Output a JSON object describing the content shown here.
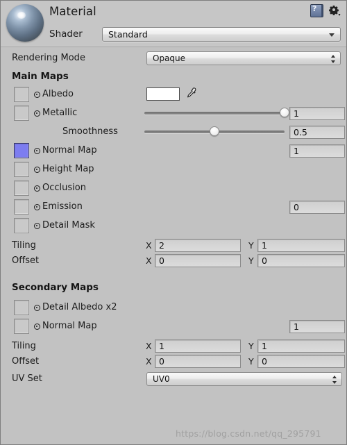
{
  "header": {
    "title": "Material",
    "shader_label": "Shader",
    "shader_value": "Standard",
    "help_icon": "help-book-icon",
    "settings_icon": "gear-icon",
    "preview_icon": "material-preview-sphere"
  },
  "rendering_mode": {
    "label": "Rendering Mode",
    "value": "Opaque"
  },
  "main_maps": {
    "heading": "Main Maps",
    "slots": [
      {
        "label": "Albedo",
        "filled": false,
        "swatch": "#ffffff",
        "has_color": true,
        "picker_icon": "eyedropper-icon"
      },
      {
        "label": "Metallic",
        "filled": false,
        "slider": 1,
        "value": "1"
      },
      {
        "label": "Smoothness",
        "filled": null,
        "slider": 0.5,
        "value": "0.5",
        "indented": true
      },
      {
        "label": "Normal Map",
        "filled": true,
        "swatch_color": "#7d7df0",
        "value": "1"
      },
      {
        "label": "Height Map",
        "filled": false
      },
      {
        "label": "Occlusion",
        "filled": false
      },
      {
        "label": "Emission",
        "filled": false,
        "value": "0"
      },
      {
        "label": "Detail Mask",
        "filled": false
      }
    ],
    "tiling": {
      "label": "Tiling",
      "x_label": "X",
      "x": "2",
      "y_label": "Y",
      "y": "1"
    },
    "offset": {
      "label": "Offset",
      "x_label": "X",
      "x": "0",
      "y_label": "Y",
      "y": "0"
    }
  },
  "secondary_maps": {
    "heading": "Secondary Maps",
    "slots": [
      {
        "label": "Detail Albedo x2",
        "filled": false
      },
      {
        "label": "Normal Map",
        "filled": false,
        "value": "1"
      }
    ],
    "tiling": {
      "label": "Tiling",
      "x_label": "X",
      "x": "1",
      "y_label": "Y",
      "y": "1"
    },
    "offset": {
      "label": "Offset",
      "x_label": "X",
      "x": "0",
      "y_label": "Y",
      "y": "0"
    },
    "uv_set": {
      "label": "UV Set",
      "value": "UV0"
    }
  },
  "watermark": "https://blog.csdn.net/qq_295791"
}
